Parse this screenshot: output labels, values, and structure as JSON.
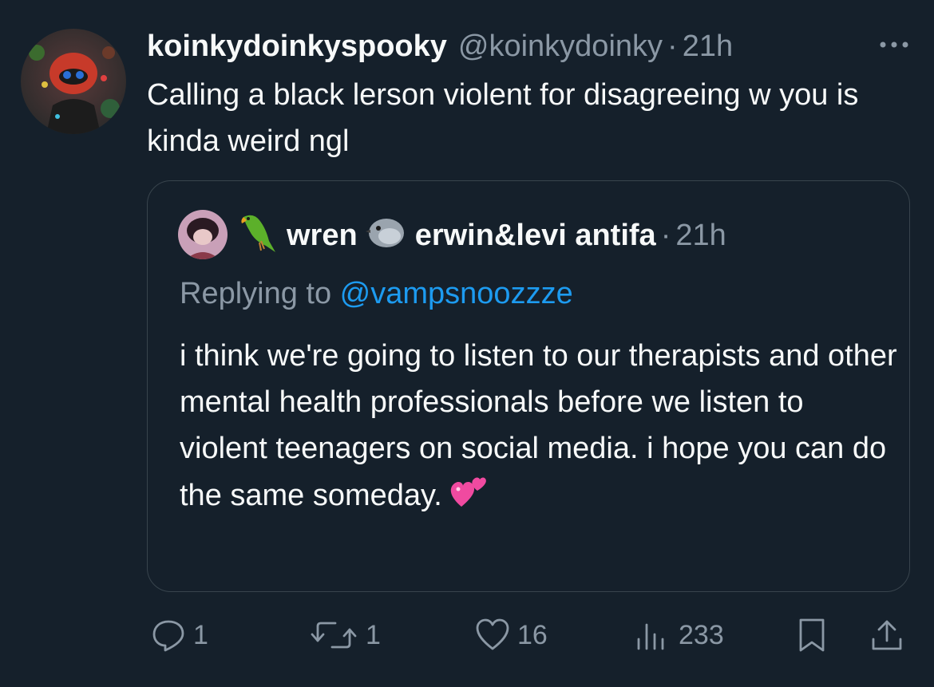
{
  "tweet": {
    "display_name": "koinkydoinkyspooky",
    "handle": "@koinkydoinky",
    "separator": "·",
    "time": "21h",
    "text": "Calling a black lerson violent for disagreeing w you is kinda weird ngl"
  },
  "quoted": {
    "name": "wren",
    "name2": "erwin&levi antifa",
    "separator": "·",
    "time": "21h",
    "replying_prefix": "Replying to ",
    "replying_handle": "@vampsnoozzze",
    "text": "i think we're going to listen to our therapists and other mental health professionals before we listen to violent teenagers on social media. i hope you can do the same someday."
  },
  "actions": {
    "replies": "1",
    "reposts": "1",
    "likes": "16",
    "views": "233"
  },
  "icons": {
    "more": "more-horizontal-icon",
    "reply": "reply-icon",
    "repost": "repost-icon",
    "like": "heart-icon",
    "views": "views-icon",
    "bookmark": "bookmark-icon",
    "share": "share-icon",
    "emoji1": "parrot-emoji",
    "emoji2": "dove-emoji",
    "emoji3": "two-hearts-emoji"
  },
  "colors": {
    "background": "#15202b",
    "text": "#f7f9f9",
    "muted": "#8b98a5",
    "link": "#1d9bf0",
    "border": "#38444d"
  }
}
